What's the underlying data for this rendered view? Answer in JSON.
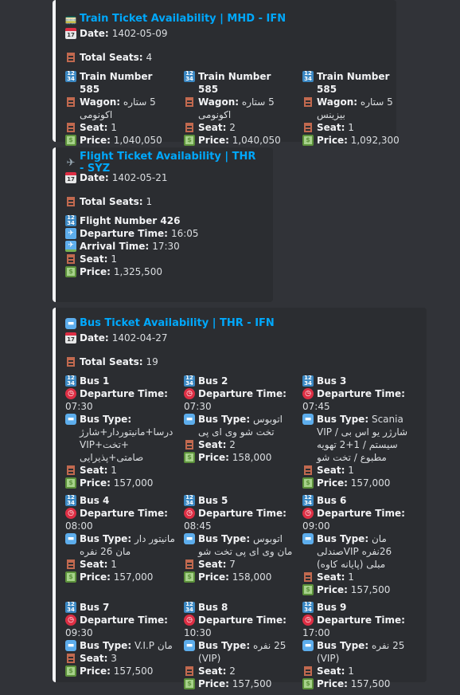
{
  "train": {
    "title": "Train Ticket Availability | MHD - IFN",
    "date_label": "Date:",
    "date": "1402-05-09",
    "total_label": "Total Seats:",
    "total": "4",
    "tickets": [
      {
        "train_label": "Train Number 585",
        "wagon_label": "Wagon:",
        "wagon": "5 ستاره اکونومی",
        "seat_label": "Seat:",
        "seat": "1",
        "price_label": "Price:",
        "price": "1,040,050"
      },
      {
        "train_label": "Train Number 585",
        "wagon_label": "Wagon:",
        "wagon": "5 ستاره اکونومی",
        "seat_label": "Seat:",
        "seat": "2",
        "price_label": "Price:",
        "price": "1,040,050"
      },
      {
        "train_label": "Train Number 585",
        "wagon_label": "Wagon:",
        "wagon": "5 ستاره بیزینس",
        "seat_label": "Seat:",
        "seat": "1",
        "price_label": "Price:",
        "price": "1,092,300"
      }
    ]
  },
  "flight": {
    "title": "Flight Ticket Availability | THR - SYZ",
    "date_label": "Date:",
    "date": "1402-05-21",
    "total_label": "Total Seats:",
    "total": "1",
    "flight_number": "Flight Number 426",
    "departure_label": "Departure Time:",
    "departure": "16:05",
    "arrival_label": "Arrival Time:",
    "arrival": "17:30",
    "seat_label": "Seat:",
    "seat": "1",
    "price_label": "Price:",
    "price": "1,325,500"
  },
  "bus": {
    "title": "Bus Ticket Availability | THR - IFN",
    "date_label": "Date:",
    "date": "1402-04-27",
    "total_label": "Total Seats:",
    "total": "19",
    "labels": {
      "departure": "Departure Time:",
      "type": "Bus Type:",
      "seat": "Seat:",
      "price": "Price:"
    },
    "buses": [
      {
        "name": "Bus 1",
        "departure": "07:30",
        "type": "درسا+مانیتوردار+شارژ+تخت+VIP صامتی+پذیرایی",
        "seat": "1",
        "price": "157,000"
      },
      {
        "name": "Bus 2",
        "departure": "07:30",
        "type": "اتوبوس تخت شو وی ای پی",
        "seat": "2",
        "price": "158,000"
      },
      {
        "name": "Bus 3",
        "departure": "07:45",
        "type": "Scania VIP شارژر یو اس بی / سیستم / 1+2 تهویه مطبوع / تخت شو",
        "seat": "1",
        "price": "157,000"
      },
      {
        "name": "Bus 4",
        "departure": "08:00",
        "type": "مانیتور دار مان 26 نفره",
        "seat": "1",
        "price": "157,000"
      },
      {
        "name": "Bus 5",
        "departure": "08:45",
        "type": "اتوبوس مان وی ای پی تخت شو",
        "seat": "7",
        "price": "158,000"
      },
      {
        "name": "Bus 6",
        "departure": "09:00",
        "type": "مان 26نفره VIPصندلی مبلی (پایانه کاوه)",
        "seat": "1",
        "price": "157,500"
      },
      {
        "name": "Bus 7",
        "departure": "09:30",
        "type": "مان V.I.P",
        "seat": "3",
        "price": "157,500"
      },
      {
        "name": "Bus 8",
        "departure": "10:30",
        "type": "25 نفره (VIP)",
        "seat": "2",
        "price": "157,500"
      },
      {
        "name": "Bus 9",
        "departure": "17:00",
        "type": "25 نفره (VIP)",
        "seat": "1",
        "price": "157,500"
      }
    ]
  }
}
